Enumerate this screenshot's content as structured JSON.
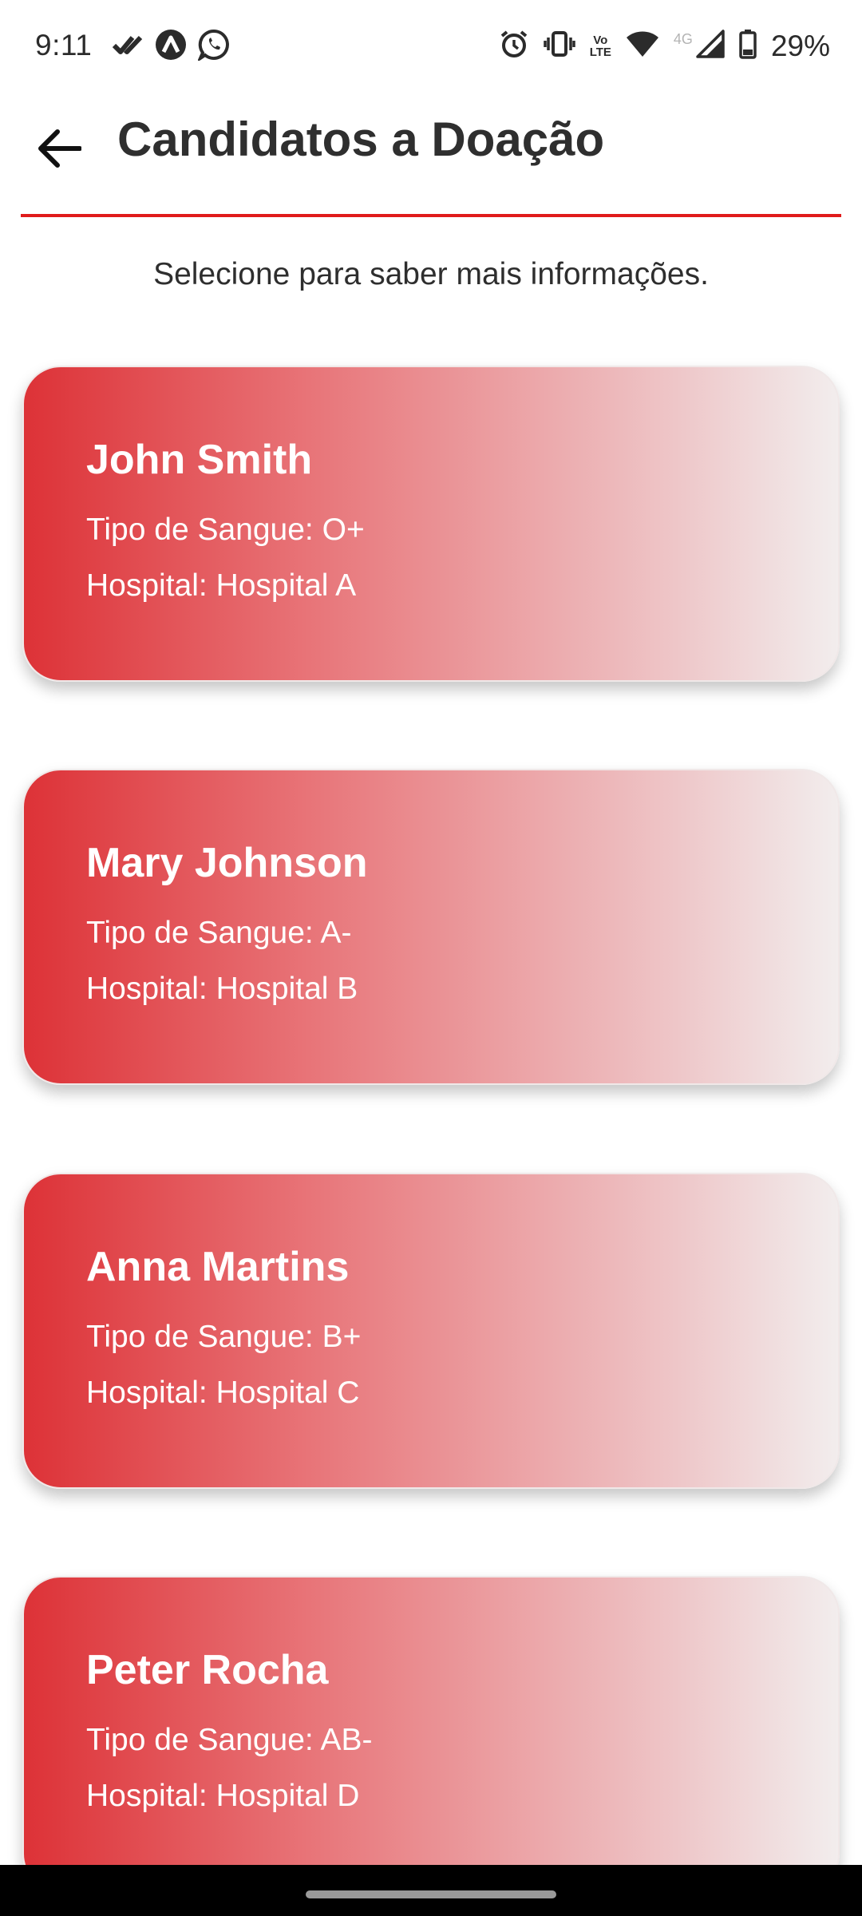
{
  "status_bar": {
    "time": "9:11",
    "battery": "29%",
    "network_small": "4G",
    "lte_top": "Vo",
    "lte_bottom": "LTE",
    "icons_left": [
      "check-double-icon",
      "app-a-icon",
      "whatsapp-icon"
    ],
    "icons_right": [
      "alarm-icon",
      "vibrate-icon",
      "volte-icon",
      "wifi-icon",
      "signal-icon",
      "battery-icon"
    ]
  },
  "header": {
    "title": "Candidatos a Doação",
    "back_icon": "arrow-left-icon",
    "divider_color": "#e01b1b"
  },
  "subtitle": "Selecione para saber mais informações.",
  "candidates": [
    {
      "name": "John Smith",
      "blood": "Tipo de Sangue: O+",
      "hospital": "Hospital: Hospital A"
    },
    {
      "name": "Mary Johnson",
      "blood": "Tipo de Sangue: A-",
      "hospital": "Hospital: Hospital B"
    },
    {
      "name": "Anna Martins",
      "blood": "Tipo de Sangue: B+",
      "hospital": "Hospital: Hospital C"
    },
    {
      "name": "Peter Rocha",
      "blood": "Tipo de Sangue: AB-",
      "hospital": "Hospital: Hospital D"
    }
  ],
  "colors": {
    "card_gradient_start": "#dd3237",
    "card_gradient_end": "#f2eded",
    "accent": "#e01b1b"
  }
}
